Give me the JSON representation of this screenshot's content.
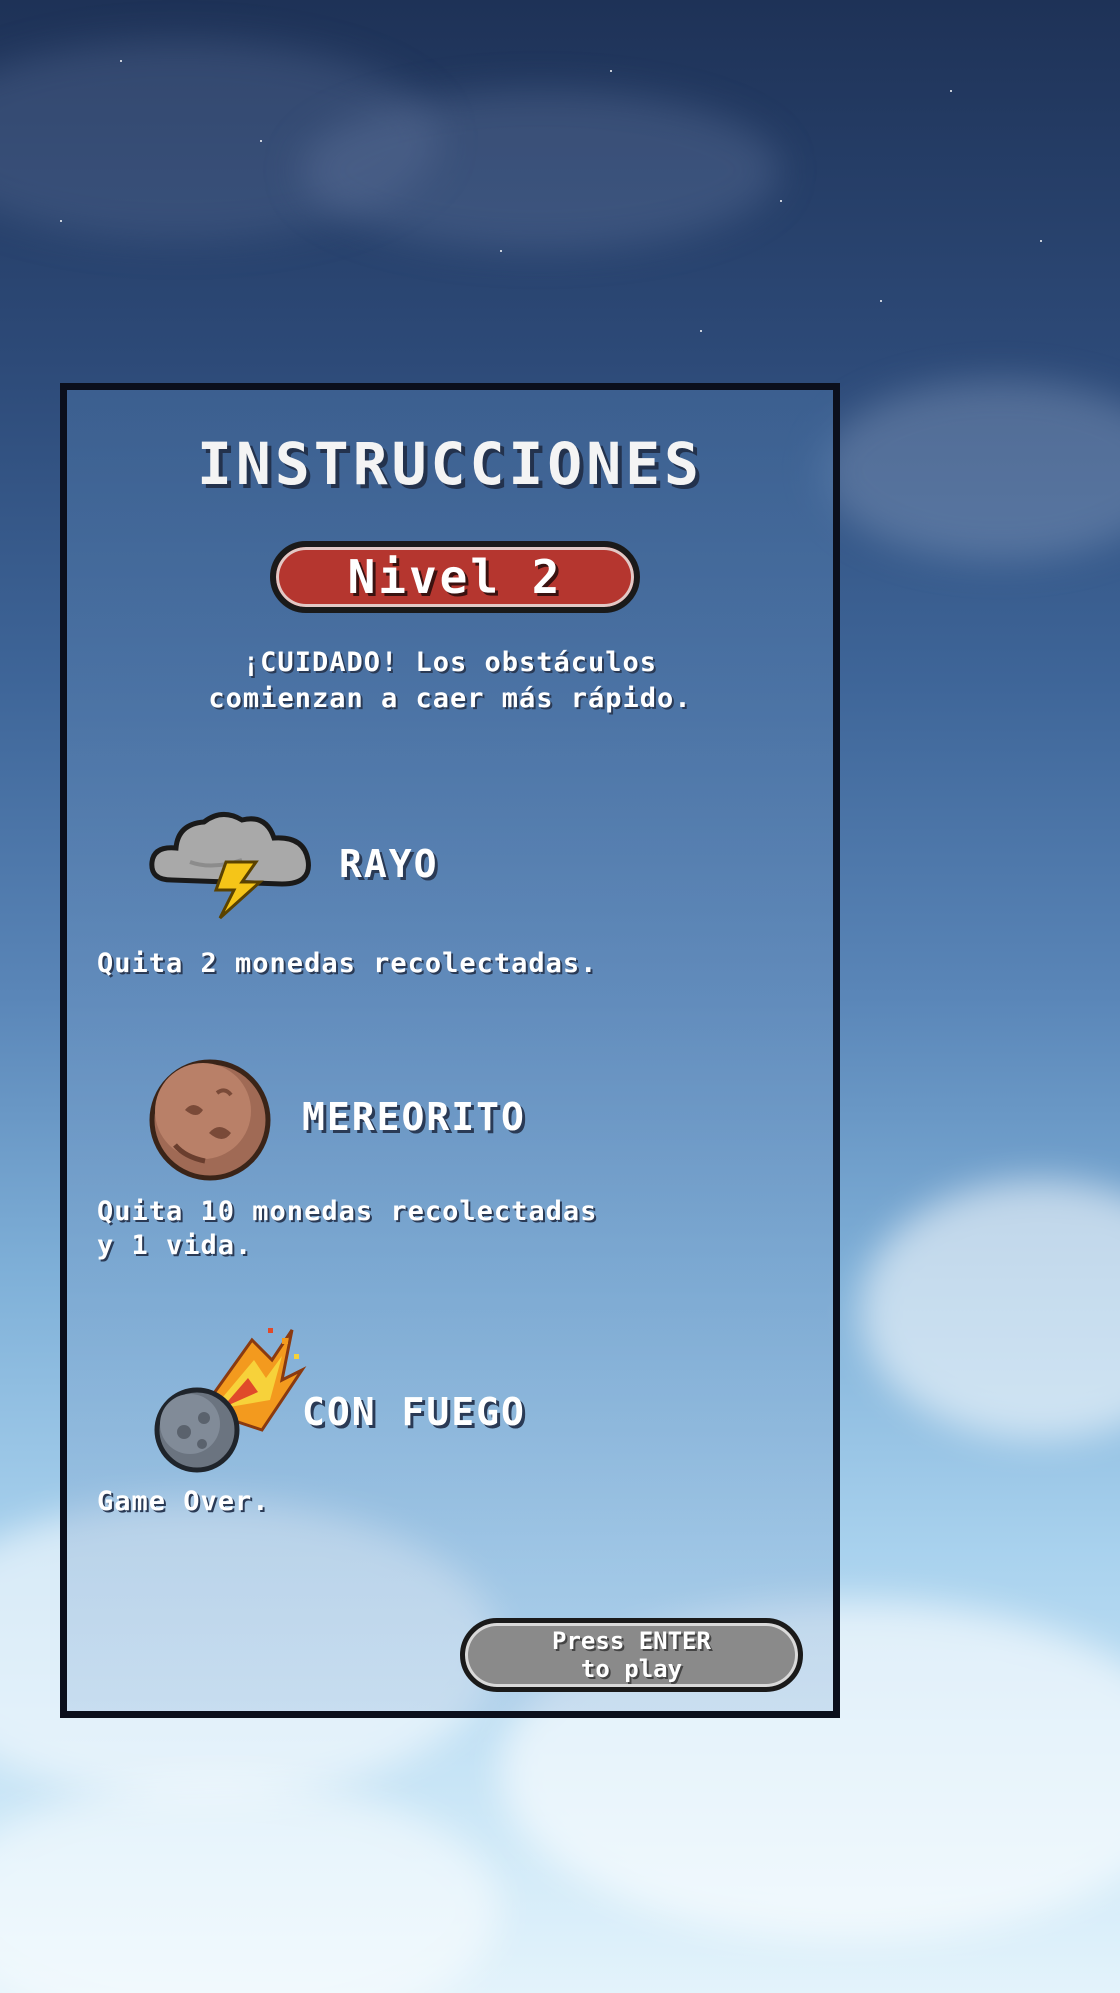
{
  "screen": {
    "title": "INSTRUCCIONES",
    "level_label": "Nivel 2",
    "warning_line1": "¡CUIDADO! Los obstáculos",
    "warning_line2": "comienzan a caer más rápido."
  },
  "items": [
    {
      "name": "RAYO",
      "description_line1": "Quita 2 monedas recolectadas.",
      "description_line2": "",
      "icon": "lightning-cloud-icon"
    },
    {
      "name": "MEREORITO",
      "description_line1": "Quita 10 monedas recolectadas",
      "description_line2": "y 1 vida.",
      "icon": "meteorite-icon"
    },
    {
      "name": "CON FUEGO",
      "description_line1": "Game Over.",
      "description_line2": "",
      "icon": "fire-meteor-icon"
    }
  ],
  "play_button": {
    "line1": "Press ENTER",
    "line2": "to play"
  },
  "colors": {
    "level_badge": "#b5362f",
    "panel_border": "#0b0f1c",
    "play_button": "#8a8a8a",
    "lightning": "#f5c518"
  }
}
